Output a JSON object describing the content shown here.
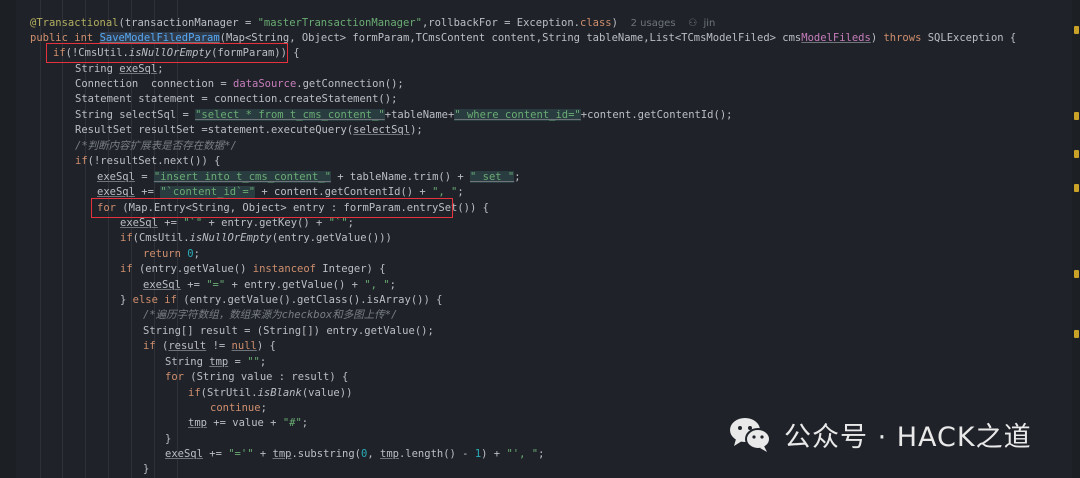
{
  "code": {
    "l1": {
      "annotation": "@Transactional",
      "args": "(transactionManager = ",
      "str": "\"masterTransactionManager\"",
      "rest": ",rollbackFor = Exception.",
      "cls": "class",
      "close": ")",
      "hint": "2 usages",
      "author": "jin"
    },
    "l2": {
      "k1": "public",
      "k2": "int",
      "fn": "SaveModelFiledParam",
      "params": "(Map<String, Object> formParam,TCmsContent content,String tableName,List<TCmsModelFiled> cms",
      "fld": "ModelFileds",
      "tail": ") ",
      "throws": "throws",
      "exc": " SQLException {"
    },
    "l3": {
      "k": "if",
      "a": "(!CmsUtil.",
      "it": "isNullOrEmpty",
      "b": "(formParam)) {"
    },
    "l4": {
      "a": "String ",
      "v": "exeSql",
      "b": ";"
    },
    "l5": {
      "a": "Connection  connection = ",
      "fld": "dataSource",
      "b": ".getConnection();"
    },
    "l6": {
      "a": "Statement statement = connection.createStatement();"
    },
    "l7": {
      "a": "String selectSql = ",
      "s1": "\"select * from t_cms_content_\"",
      "b": "+tableName+",
      "s2": "\" where content_id=\"",
      "c": "+content.getContentId();"
    },
    "l8": {
      "a": "ResultSet resultSet =statement.executeQuery(",
      "v": "selectSql",
      "b": ");"
    },
    "l9": {
      "cm": "/*判断内容扩展表是否存在数据*/"
    },
    "l10": {
      "k": "if",
      "a": "(!resultSet.next()) {"
    },
    "l11": {
      "v": "exeSql",
      "a": " = ",
      "s": "\"insert into t_cms_content_\"",
      "b": " + tableName.trim() + ",
      "s2": "\" set \"",
      "c": ";"
    },
    "l12": {
      "v": "exeSql",
      "a": " += ",
      "s": "\"`content_id`=\"",
      "b": " + content.getContentId() + ",
      "s2": "\", \"",
      "c": ";"
    },
    "l13": {
      "k": "for",
      "a": " (Map.Entry<String, Object> entry : formParam.entrySet()) {"
    },
    "l14": {
      "v": "exeSql",
      "a": " += ",
      "s": "\"`\"",
      "b": " + entry.getKey() + ",
      "s2": "\"`\"",
      "c": ";"
    },
    "l15": {
      "k": "if",
      "a": "(CmsUtil.",
      "it": "isNullOrEmpty",
      "b": "(entry.getValue()))"
    },
    "l16": {
      "k": "return",
      "n": "0",
      "b": ";"
    },
    "l17": {
      "k": "if",
      "a": " (entry.getValue() ",
      "k2": "instanceof",
      "b": " Integer) {"
    },
    "l18": {
      "v": "exeSql",
      "a": " += ",
      "s": "\"=\"",
      "b": " + entry.getValue() + ",
      "s2": "\", \"",
      "c": ";"
    },
    "l19": {
      "a": "} ",
      "k": "else if",
      "b": " (entry.getValue().getClass().isArray()) {"
    },
    "l20": {
      "cm": "/*遍历字符数组，数组来源为checkbox和多图上传*/"
    },
    "l21": {
      "a": "String[] result = (String[]) entry.getValue();"
    },
    "l22": {
      "k": "if",
      "a": " (",
      "v": "result",
      "b": " != ",
      "k2": "null",
      "c": ") {"
    },
    "l23": {
      "a": "String ",
      "v": "tmp",
      "b": " = ",
      "s": "\"\"",
      "c": ";"
    },
    "l24": {
      "k": "for",
      "a": " (String value : result) {"
    },
    "l25": {
      "k": "if",
      "a": "(StrUtil.",
      "it": "isBlank",
      "b": "(value))"
    },
    "l26": {
      "k": "continue",
      "b": ";"
    },
    "l27": {
      "v": "tmp",
      "a": " += value + ",
      "s": "\"#\"",
      "b": ";"
    },
    "l28": {
      "a": "}"
    },
    "l29": {
      "v": "exeSql",
      "a": " += ",
      "s": "\"='\"",
      "b": " + ",
      "v2": "tmp",
      "c": ".substring(",
      "n": "0",
      "d": ", ",
      "v3": "tmp",
      "e": ".length() - ",
      "n2": "1",
      "f": ") + ",
      "s2": "\"', \"",
      "g": ";"
    },
    "l30": {
      "a": "}"
    }
  },
  "watermark": {
    "text": "公众号 · HACK之道",
    "icon": "wechat-icon"
  },
  "colors": {
    "background": "#1f2329",
    "highlight_box": "#e5323c",
    "keyword": "#cf8e6d",
    "string": "#6aab73",
    "method": "#56a8f5",
    "comment": "#7a7e85"
  }
}
